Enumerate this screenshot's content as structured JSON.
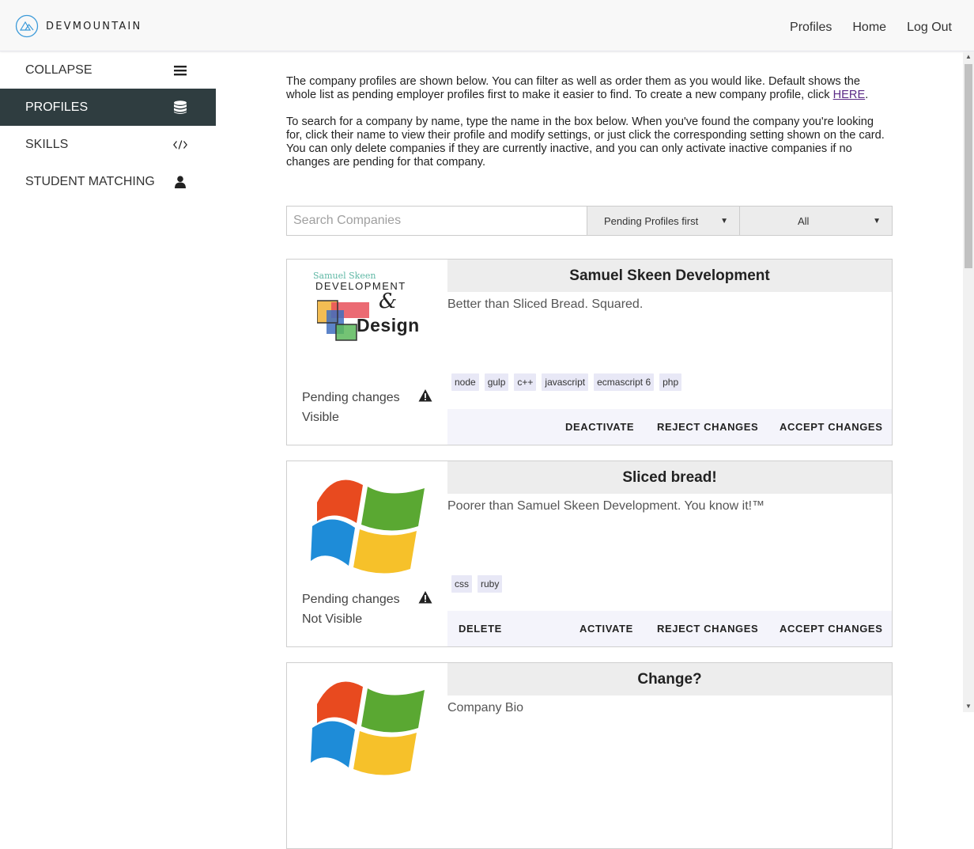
{
  "header": {
    "brand": "DEVMOUNTAIN",
    "nav": [
      "Profiles",
      "Home",
      "Log Out"
    ]
  },
  "sidebar": {
    "items": [
      {
        "label": "COLLAPSE",
        "icon": "hamburger-icon"
      },
      {
        "label": "PROFILES",
        "icon": "database-icon",
        "active": true
      },
      {
        "label": "SKILLS",
        "icon": "code-icon"
      },
      {
        "label": "STUDENT MATCHING",
        "icon": "user-icon"
      }
    ]
  },
  "main": {
    "intro1": "The company profiles are shown below. You can filter as well as order them as you would like. Default shows the whole list as pending employer profiles first to make it easier to find. To create a new company profile, click ",
    "intro1_link": "HERE",
    "intro1_end": ".",
    "intro2": "To search for a company by name, type the name in the box below. When you've found the company you're looking for, click their name to view their profile and modify settings, or just click the corresponding setting shown on the card. You can only delete companies if they are currently inactive, and you can only activate inactive companies if no changes are pending for that company.",
    "search_placeholder": "Search Companies",
    "sort_value": "Pending Profiles first",
    "filter_value": "All"
  },
  "cards": [
    {
      "title": "Samuel Skeen Development",
      "bio": "Better than Sliced Bread. Squared.",
      "tags": [
        "node",
        "gulp",
        "c++",
        "javascript",
        "ecmascript 6",
        "php"
      ],
      "status1": "Pending changes",
      "status2": "Visible",
      "logo": {
        "line1": "Samuel Skeen",
        "line2": "DEVELOPMENT",
        "line3": "&",
        "line4": "Design"
      },
      "actions": [
        "DEACTIVATE",
        "REJECT CHANGES",
        "ACCEPT CHANGES"
      ]
    },
    {
      "title": "Sliced bread!",
      "bio": "Poorer than Samuel Skeen Development. You know it!™",
      "tags": [
        "css",
        "ruby"
      ],
      "status1": "Pending changes",
      "status2": "Not Visible",
      "actions": [
        "DELETE",
        "ACTIVATE",
        "REJECT CHANGES",
        "ACCEPT CHANGES"
      ]
    },
    {
      "title": "Change?",
      "bio": "Company Bio"
    }
  ],
  "colors": {
    "sidebar_active": "#2f3d40",
    "title_bg": "#ededed",
    "tag_bg": "#e8e8f6",
    "link": "#5b2a86"
  }
}
